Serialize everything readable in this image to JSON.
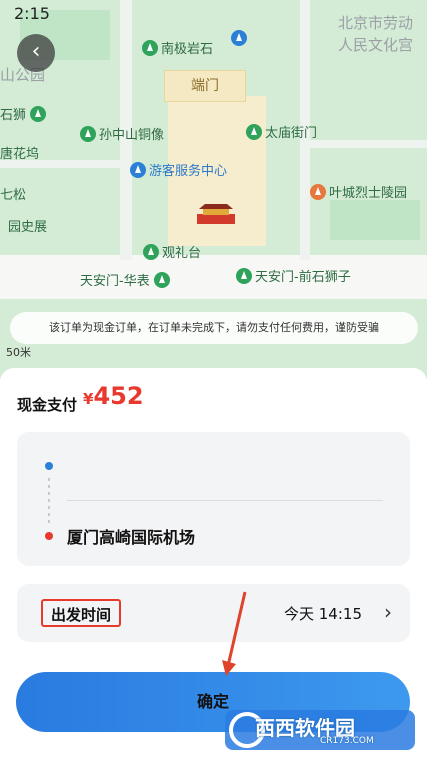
{
  "status_bar": {
    "time": "2:15"
  },
  "map": {
    "labels": {
      "nanchiyanshi": "南极岩石",
      "beijing_labor_1": "北京市劳动",
      "beijing_labor_2": "人民文化宫",
      "shan_park": "山公园",
      "duanmen": "端门",
      "shishi": "石狮",
      "sun_statue": "孙中山铜像",
      "taimiao_gate": "太庙街门",
      "tanghuawu": "唐花坞",
      "visitor_center": "游客服务中心",
      "qisong": "七松",
      "yecheng_cemetery": "叶城烈士陵园",
      "garden_exhibit": "园史展",
      "guanlitai": "观礼台",
      "tiananmen_huabiao": "天安门-华表",
      "tiananmen_lion": "天安门-前石狮子"
    },
    "notice": "该订单为现金订单，在订单未完成下，请勿支付任何费用，谨防受骗",
    "scale": "50米"
  },
  "order": {
    "pay_label": "现金支付",
    "currency": "¥",
    "amount": "452",
    "destination": "厦门高崎国际机场",
    "time_label": "出发时间",
    "time_value": "今天 14:15",
    "confirm_label": "确定"
  },
  "watermark": {
    "brand": "西西软件园",
    "url": "CR173.COM"
  },
  "colors": {
    "accent_red": "#e8392e",
    "button_blue": "#2a7be0",
    "map_green": "#d4ecd6"
  }
}
